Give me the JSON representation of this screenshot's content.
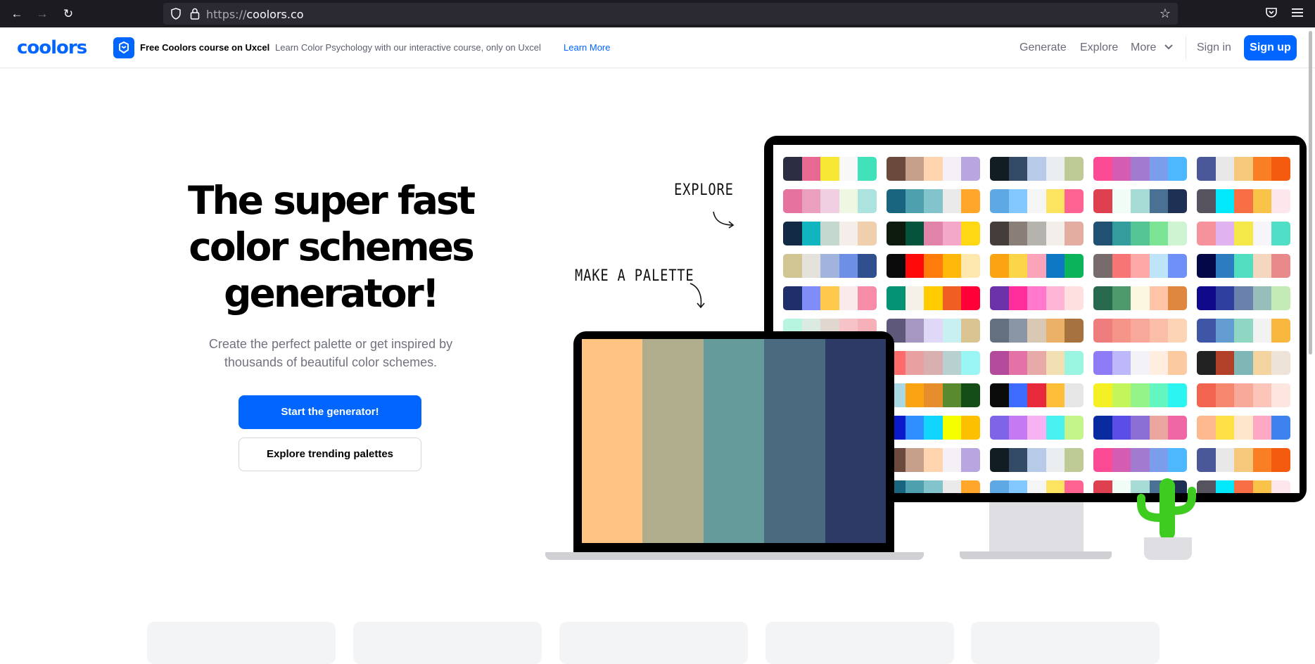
{
  "browser": {
    "url_protocol": "https://",
    "url_host": "coolors.co"
  },
  "nav": {
    "logo": "coolors",
    "promo_title": "Free Coolors course on Uxcel",
    "promo_desc": "Learn Color Psychology with our interactive course, only on Uxcel",
    "promo_link": "Learn More",
    "links": [
      "Generate",
      "Explore",
      "More"
    ],
    "sign_in": "Sign in",
    "sign_up": "Sign up"
  },
  "hero": {
    "title_line1": "The super fast",
    "title_line2": "color schemes",
    "title_line3": "generator!",
    "subtitle_line1": "Create the perfect palette or get inspired by",
    "subtitle_line2": "thousands of beautiful color schemes.",
    "primary_button": "Start the generator!",
    "secondary_button": "Explore trending palettes"
  },
  "illustration": {
    "explore_label": "EXPLORE",
    "make_palette_label": "MAKE A PALETTE",
    "laptop_palette": [
      "#ffc482",
      "#b0ad8c",
      "#659b9b",
      "#4a6a80",
      "#2d3a66"
    ],
    "monitor_palettes": [
      [
        [
          "#2b2d42",
          "#e86a92",
          "#f7e733",
          "#f8f8f8",
          "#41e2ba"
        ],
        [
          "#6b4a3d",
          "#c7a08b",
          "#ffd5b0",
          "#f5f0f5",
          "#b9a6e0"
        ],
        [
          "#121d23",
          "#344b66",
          "#b7cbe8",
          "#ebeef0",
          "#bfcb96"
        ],
        [
          "#fc4a95",
          "#d45cb3",
          "#a27bd1",
          "#7b9deb",
          "#4db8ff"
        ],
        [
          "#4a5899",
          "#e8e8e8",
          "#f5c87c",
          "#fa7f24",
          "#f55b0f"
        ]
      ],
      [
        [
          "#e6739f",
          "#eaa0bd",
          "#f0cfe3",
          "#eef7e1",
          "#ade3df"
        ],
        [
          "#19647e",
          "#4fa0ae",
          "#82c3cc",
          "#eaeaea",
          "#ffa62b"
        ],
        [
          "#5ea9e3",
          "#82c7ff",
          "#f5f5f5",
          "#fce460",
          "#ff6392"
        ],
        [
          "#de4050",
          "#f0fcf5",
          "#a7dcd6",
          "#4a7094",
          "#1e3155"
        ],
        [
          "#56535e",
          "#00e8fc",
          "#f96f45",
          "#f9c349",
          "#fde7ec"
        ]
      ],
      [
        [
          "#132a46",
          "#11b5c0",
          "#c4d8d0",
          "#f5ede9",
          "#f0cfac"
        ],
        [
          "#0d1b0e",
          "#04533b",
          "#e283a9",
          "#f3a8c9",
          "#ffd814"
        ],
        [
          "#453d3a",
          "#8a7e78",
          "#b5b3ad",
          "#f2eeea",
          "#e3ada1"
        ],
        [
          "#205072",
          "#329d9c",
          "#56c596",
          "#7be495",
          "#cff4d2"
        ],
        [
          "#f5929b",
          "#e0b3f0",
          "#f5e94a",
          "#f5f5fa",
          "#50dec7"
        ]
      ],
      [
        [
          "#d2c594",
          "#e4e2da",
          "#a1b4de",
          "#6d8fe6",
          "#314e8f"
        ],
        [
          "#0a0a0a",
          "#ff0a0a",
          "#ff7c0a",
          "#ffb70a",
          "#ffe8ad"
        ],
        [
          "#fca311",
          "#fcd549",
          "#fba3b8",
          "#0f78c5",
          "#0bb35a"
        ],
        [
          "#776b6b",
          "#f87575",
          "#fea8a8",
          "#bde4f8",
          "#6f8ff9"
        ],
        [
          "#050846",
          "#2b7dbf",
          "#52dec0",
          "#f5d7c0",
          "#e8898b"
        ]
      ],
      [
        [
          "#1f2f6b",
          "#808cf7",
          "#ffc94d",
          "#fbeaeb",
          "#f78ca8"
        ],
        [
          "#049274",
          "#f5f0e8",
          "#ffcc00",
          "#f05e23",
          "#ff0038"
        ],
        [
          "#6a31a8",
          "#ff2c9c",
          "#ff78cc",
          "#ffb5d6",
          "#ffe0e0"
        ],
        [
          "#276a4e",
          "#4e9a6d",
          "#fbf7e0",
          "#ffc3a7",
          "#e0873f"
        ],
        [
          "#0f0a8a",
          "#2f3fa0",
          "#6a80ad",
          "#98bebb",
          "#c4eab6"
        ]
      ],
      [
        [
          "#b8f5e0",
          "#dcebe1",
          "#e0d8d0",
          "#f5c3c8",
          "#f5b0b8"
        ],
        [
          "#5e587b",
          "#a597c2",
          "#dfd8f7",
          "#c9f0f0",
          "#dac592"
        ],
        [
          "#646f80",
          "#8a96a6",
          "#d9c8b4",
          "#eab068",
          "#a57240"
        ],
        [
          "#f07d7d",
          "#f5958a",
          "#f7a89a",
          "#fcbea8",
          "#fdd5b4"
        ],
        [
          "#3f55a6",
          "#629cd1",
          "#8fd7c3",
          "#f2f2f2",
          "#f8b73f"
        ]
      ],
      [
        [
          "#f7c6c6",
          "#f9a0a0",
          "#ff6b6b",
          "#e89c9c",
          "#cfa8a8"
        ],
        [
          "#ff6b6b",
          "#e8a0a0",
          "#d9b0b0",
          "#b8d0d0",
          "#9af5f5"
        ],
        [
          "#b44b9a",
          "#e372a7",
          "#e8a9a9",
          "#f2e0b4",
          "#9af5e0"
        ],
        [
          "#8e7cf7",
          "#bcb8fa",
          "#f2f2f7",
          "#ffeee0",
          "#fccaa0"
        ],
        [
          "#222222",
          "#b24028",
          "#7fb6b6",
          "#f3d4a0",
          "#ede3d8"
        ]
      ],
      [
        [
          "#0a1aa8",
          "#1f46ff",
          "#7ca6ff",
          "#b3d1ff",
          "#e6f0ff"
        ],
        [
          "#a9d7e3",
          "#fca311",
          "#e58e2b",
          "#5a8a2f",
          "#144e16"
        ],
        [
          "#0a0a0a",
          "#3e6cff",
          "#e8293b",
          "#ffbe37",
          "#e6e6e6"
        ],
        [
          "#f4f023",
          "#c3f65b",
          "#94f48a",
          "#63f6c1",
          "#2cf4f0"
        ],
        [
          "#f26450",
          "#f5876f",
          "#f9a99a",
          "#fcc5ba",
          "#fde5e0"
        ]
      ],
      [
        [
          "#0a1ac8",
          "#2f8ffe",
          "#10d5fd",
          "#f6ff00",
          "#fcc000"
        ],
        [
          "#0a1ac8",
          "#2f8ffe",
          "#10d5fd",
          "#f6ff00",
          "#fcc000"
        ],
        [
          "#8064e8",
          "#c579f2",
          "#f7b2f4",
          "#48f0f0",
          "#c3f58b"
        ],
        [
          "#0a2aa0",
          "#5b4de8",
          "#8b6fd4",
          "#eca6a0",
          "#f067a5"
        ],
        [
          "#fdb88d",
          "#fde145",
          "#fde6c9",
          "#fda8c5",
          "#3e82ef"
        ]
      ],
      [
        [
          "#6b4a3d",
          "#c7a08b",
          "#ffd5b0",
          "#f5f0f5",
          "#b9a6e0"
        ],
        [
          "#6b4a3d",
          "#c7a08b",
          "#ffd5b0",
          "#f5f0f5",
          "#b9a6e0"
        ],
        [
          "#121d23",
          "#344b66",
          "#b7cbe8",
          "#ebeef0",
          "#bfcb96"
        ],
        [
          "#fc4a95",
          "#d45cb3",
          "#a27bd1",
          "#7b9deb",
          "#4db8ff"
        ],
        [
          "#4a5899",
          "#e8e8e8",
          "#f5c87c",
          "#fa7f24",
          "#f55b0f"
        ]
      ],
      [
        [
          "#19647e",
          "#4fa0ae",
          "#82c3cc",
          "#eaeaea",
          "#ffa62b"
        ],
        [
          "#19647e",
          "#4fa0ae",
          "#82c3cc",
          "#eaeaea",
          "#ffa62b"
        ],
        [
          "#5ea9e3",
          "#82c7ff",
          "#f5f5f5",
          "#fce460",
          "#ff6392"
        ],
        [
          "#de4050",
          "#f0fcf5",
          "#a7dcd6",
          "#4a7094",
          "#1e3155"
        ],
        [
          "#56535e",
          "#00e8fc",
          "#f96f45",
          "#f9c349",
          "#fde7ec"
        ]
      ]
    ]
  },
  "colors": {
    "brand": "#0066ff",
    "cactus": "#3dcc1f"
  }
}
